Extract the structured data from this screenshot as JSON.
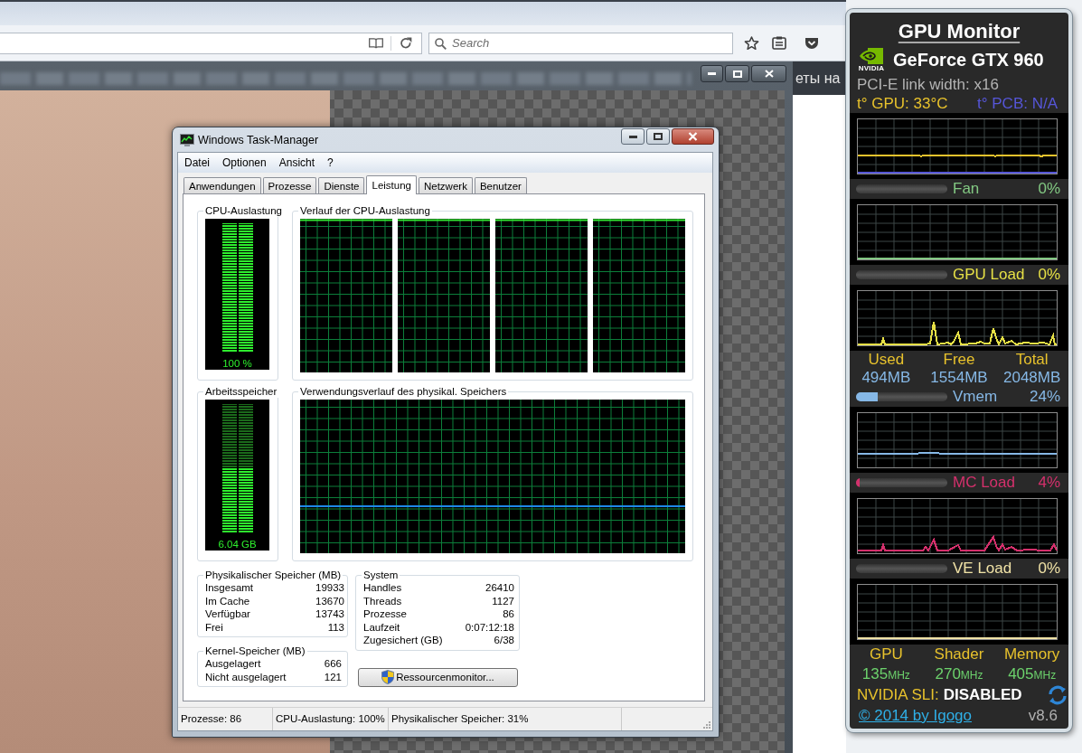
{
  "browser": {
    "search": {
      "placeholder": "Search"
    },
    "banner_text": "еты на"
  },
  "task_manager": {
    "title": "Windows Task-Manager",
    "menu": [
      "Datei",
      "Optionen",
      "Ansicht",
      "?"
    ],
    "tabs": [
      {
        "label": "Anwendungen",
        "selected": false
      },
      {
        "label": "Prozesse",
        "selected": false
      },
      {
        "label": "Dienste",
        "selected": false
      },
      {
        "label": "Leistung",
        "selected": true
      },
      {
        "label": "Netzwerk",
        "selected": false
      },
      {
        "label": "Benutzer",
        "selected": false
      }
    ],
    "cpu_usage": {
      "title": "CPU-Auslastung",
      "reading": "100 %",
      "level": 1
    },
    "cpu_history": {
      "title": "Verlauf der CPU-Auslastung"
    },
    "memory": {
      "title": "Arbeitsspeicher",
      "reading": "6.04 GB",
      "level": 0.5
    },
    "memory_history": {
      "title": "Verwendungsverlauf des physikal. Speichers"
    },
    "physical_memory": {
      "title": "Physikalischer Speicher (MB)",
      "rows": [
        {
          "label": "Insgesamt",
          "value": "19933"
        },
        {
          "label": "Im Cache",
          "value": "13670"
        },
        {
          "label": "Verfügbar",
          "value": "13743"
        },
        {
          "label": "Frei",
          "value": "113"
        }
      ]
    },
    "kernel_memory": {
      "title": "Kernel-Speicher (MB)",
      "rows": [
        {
          "label": "Ausgelagert",
          "value": "666"
        },
        {
          "label": "Nicht ausgelagert",
          "value": "121"
        }
      ]
    },
    "system": {
      "title": "System",
      "rows": [
        {
          "label": "Handles",
          "value": "26410"
        },
        {
          "label": "Threads",
          "value": "1127"
        },
        {
          "label": "Prozesse",
          "value": "86"
        },
        {
          "label": "Laufzeit",
          "value": "0:07:12:18"
        },
        {
          "label": "Zugesichert (GB)",
          "value": "6/38"
        }
      ]
    },
    "resource_monitor_button": "Ressourcenmonitor...",
    "status_bar": [
      "Prozesse: 86",
      "CPU-Auslastung: 100%",
      "Physikalischer Speicher: 31%"
    ]
  },
  "gpu_monitor": {
    "title": "GPU Monitor",
    "logo_text": "NVIDIA",
    "gpu_name": "GeForce GTX 960",
    "link_width": "PCI-E link width: x16",
    "temperatures": [
      {
        "text": "t° GPU: 33°C",
        "color": "#e8c22c"
      },
      {
        "text": "t° PCB: N/A",
        "color": "#5656d8"
      }
    ],
    "meters": [
      {
        "label": "Fan",
        "reading": "0%",
        "color": "#82c882"
      },
      {
        "label": "GPU Load",
        "reading": "0%",
        "color": "#e6e046"
      },
      {
        "label": "Vmem",
        "reading": "24%",
        "level": 0.24,
        "color": "#86b8e6",
        "stats": [
          {
            "label": "Used",
            "value": "494MB"
          },
          {
            "label": "Free",
            "value": "1554MB"
          },
          {
            "label": "Total",
            "value": "2048MB"
          }
        ]
      },
      {
        "label": "MC Load",
        "reading": "4%",
        "level": 0.04,
        "color": "#d4306c"
      },
      {
        "label": "VE Load",
        "reading": "0%",
        "color": "#f0e2a6"
      }
    ],
    "clocks": [
      {
        "label": "GPU",
        "value": "135",
        "unit": "MHz"
      },
      {
        "label": "Shader",
        "value": "270",
        "unit": "MHz"
      },
      {
        "label": "Memory",
        "value": "405",
        "unit": "MHz"
      }
    ],
    "sli": {
      "label": "NVIDIA SLI:",
      "value": "DISABLED"
    },
    "credit_link": "© 2014 by Igogo",
    "version": "v8.6"
  }
}
